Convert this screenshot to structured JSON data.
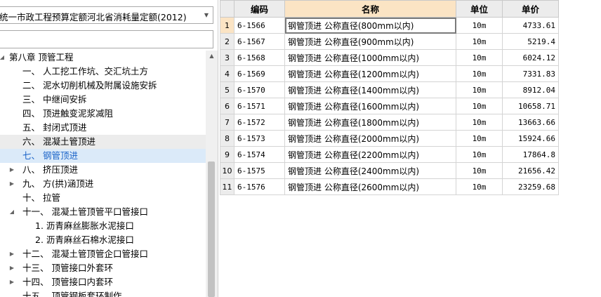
{
  "library_select": {
    "value": "统一市政工程预算定额河北省消耗量定额(2012)"
  },
  "search": {
    "placeholder": ""
  },
  "tree": [
    {
      "toggle": "◢",
      "label": "第八章  顶管工程",
      "level": 0,
      "state": ""
    },
    {
      "toggle": "",
      "label": "一、  人工挖工作坑、交汇坑土方",
      "level": 1,
      "state": ""
    },
    {
      "toggle": "",
      "label": "二、  泥水切削机械及附属设施安拆",
      "level": 1,
      "state": ""
    },
    {
      "toggle": "",
      "label": "三、  中继间安拆",
      "level": 1,
      "state": ""
    },
    {
      "toggle": "",
      "label": "四、  顶进触变泥浆减阻",
      "level": 1,
      "state": ""
    },
    {
      "toggle": "",
      "label": "五、  封闭式顶进",
      "level": 1,
      "state": ""
    },
    {
      "toggle": "",
      "label": "六、  混凝土管顶进",
      "level": 1,
      "state": "hl"
    },
    {
      "toggle": "",
      "label": "七、  钢管顶进",
      "level": 1,
      "state": "sel"
    },
    {
      "toggle": "▶",
      "label": "八、  挤压顶进",
      "level": 1,
      "state": ""
    },
    {
      "toggle": "▶",
      "label": "九、  方(拱)涵顶进",
      "level": 1,
      "state": ""
    },
    {
      "toggle": "",
      "label": "十、  拉管",
      "level": 1,
      "state": ""
    },
    {
      "toggle": "◢",
      "label": "十一、  混凝土管顶管平口管接口",
      "level": 1,
      "state": ""
    },
    {
      "toggle": "",
      "label": "1.  沥青麻丝膨胀水泥接口",
      "level": 2,
      "state": ""
    },
    {
      "toggle": "",
      "label": "2.  沥青麻丝石棉水泥接口",
      "level": 2,
      "state": ""
    },
    {
      "toggle": "▶",
      "label": "十二、  混凝土管顶管企口管接口",
      "level": 1,
      "state": ""
    },
    {
      "toggle": "▶",
      "label": "十三、  顶管接口外套环",
      "level": 1,
      "state": ""
    },
    {
      "toggle": "▶",
      "label": "十四、  顶管接口内套环",
      "level": 1,
      "state": ""
    },
    {
      "toggle": "",
      "label": "十五、  顶管钢板套环制作",
      "level": 1,
      "state": ""
    }
  ],
  "grid": {
    "headers": {
      "code": "编码",
      "name": "名称",
      "unit": "单位",
      "price": "单价"
    },
    "rows": [
      {
        "n": "1",
        "code": "6-1566",
        "name": "钢管顶进 公称直径(800mm以内)",
        "unit": "10m",
        "price": "4733.61"
      },
      {
        "n": "2",
        "code": "6-1567",
        "name": "钢管顶进 公称直径(900mm以内)",
        "unit": "10m",
        "price": "5219.4"
      },
      {
        "n": "3",
        "code": "6-1568",
        "name": "钢管顶进 公称直径(1000mm以内)",
        "unit": "10m",
        "price": "6024.12"
      },
      {
        "n": "4",
        "code": "6-1569",
        "name": "钢管顶进 公称直径(1200mm以内)",
        "unit": "10m",
        "price": "7331.83"
      },
      {
        "n": "5",
        "code": "6-1570",
        "name": "钢管顶进 公称直径(1400mm以内)",
        "unit": "10m",
        "price": "8912.04"
      },
      {
        "n": "6",
        "code": "6-1571",
        "name": "钢管顶进 公称直径(1600mm以内)",
        "unit": "10m",
        "price": "10658.71"
      },
      {
        "n": "7",
        "code": "6-1572",
        "name": "钢管顶进 公称直径(1800mm以内)",
        "unit": "10m",
        "price": "13663.66"
      },
      {
        "n": "8",
        "code": "6-1573",
        "name": "钢管顶进 公称直径(2000mm以内)",
        "unit": "10m",
        "price": "15924.66"
      },
      {
        "n": "9",
        "code": "6-1574",
        "name": "钢管顶进 公称直径(2200mm以内)",
        "unit": "10m",
        "price": "17864.8"
      },
      {
        "n": "10",
        "code": "6-1575",
        "name": "钢管顶进 公称直径(2400mm以内)",
        "unit": "10m",
        "price": "21656.42"
      },
      {
        "n": "11",
        "code": "6-1576",
        "name": "钢管顶进 公称直径(2600mm以内)",
        "unit": "10m",
        "price": "23259.68"
      }
    ]
  }
}
